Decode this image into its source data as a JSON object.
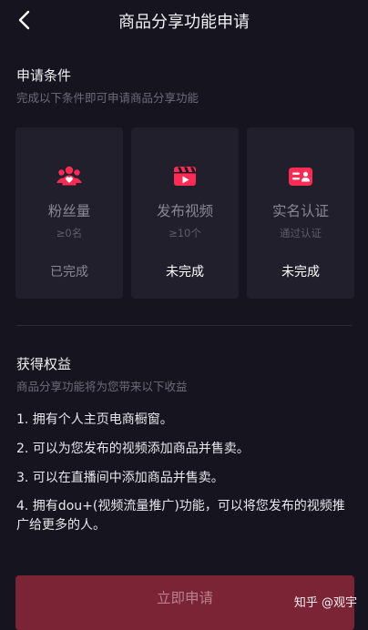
{
  "header": {
    "title": "商品分享功能申请"
  },
  "conditions": {
    "title": "申请条件",
    "subtitle": "完成以下条件即可申请商品分享功能",
    "cards": [
      {
        "name": "粉丝量",
        "requirement": "≥0名",
        "status": "已完成",
        "icon": "fans-icon"
      },
      {
        "name": "发布视频",
        "requirement": "≥10个",
        "status": "未完成",
        "icon": "video-icon"
      },
      {
        "name": "实名认证",
        "requirement": "通过认证",
        "status": "未完成",
        "icon": "id-card-icon"
      }
    ]
  },
  "benefits": {
    "title": "获得权益",
    "subtitle": "商品分享功能将为您带来以下收益",
    "items": [
      "1. 拥有个人主页电商橱窗。",
      "2. 可以为您发布的视频添加商品并售卖。",
      "3. 可以在直播间中添加商品并售卖。",
      "4. 拥有dou+(视频流量推广)功能，可以将您发布的视频推广给更多的人。"
    ]
  },
  "apply_button": {
    "label": "立即申请"
  },
  "watermark": {
    "text": "知乎 @观宇"
  },
  "colors": {
    "background": "#16141f",
    "card": "#211f2b",
    "accent": "#fe2c55",
    "button": "#7a2436"
  }
}
